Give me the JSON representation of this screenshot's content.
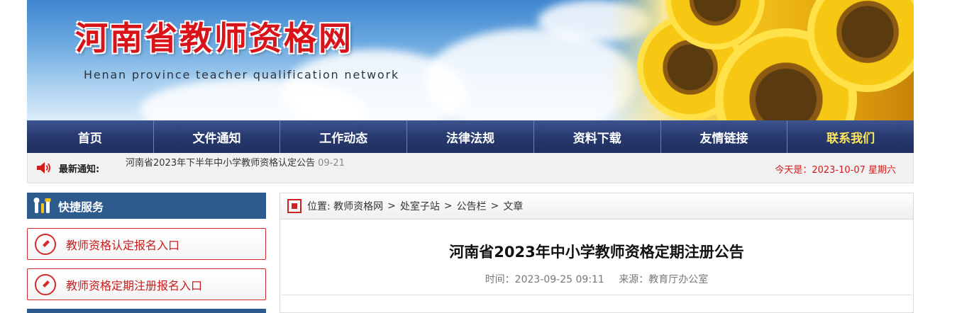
{
  "header": {
    "title": "河南省教师资格网",
    "subtitle": "Henan province teacher qualification network"
  },
  "nav": {
    "items": [
      {
        "label": "首页"
      },
      {
        "label": "文件通知"
      },
      {
        "label": "工作动态"
      },
      {
        "label": "法律法规"
      },
      {
        "label": "资料下载"
      },
      {
        "label": "友情链接"
      },
      {
        "label": "联系我们"
      }
    ],
    "highlight_color": "#ffe65a"
  },
  "notice": {
    "label": "最新通知:",
    "item_text": "河南省2023年下半年中小学教师资格认定公告",
    "item_date": "09-21",
    "today": "今天是：2023-10-07  星期六",
    "speaker_icon": "speaker-icon"
  },
  "sidebar": {
    "heading": "快捷服务",
    "heading_icon": "tools-icon",
    "buttons": [
      {
        "label": "教师资格认定报名入口",
        "icon": "pen-icon"
      },
      {
        "label": "教师资格定期注册报名入口",
        "icon": "pen-icon"
      }
    ]
  },
  "breadcrumb": {
    "prefix": "位置:",
    "items": [
      "教师资格网",
      "处室子站",
      "公告栏",
      "文章"
    ],
    "separator": ">"
  },
  "article": {
    "title": "河南省2023年中小学教师资格定期注册公告",
    "time": "时间：2023-09-25 09:11",
    "source": "来源：教育厅办公室"
  },
  "colors": {
    "nav_bg": "#27396e",
    "accent_red": "#d12b2b",
    "sidebar_blue": "#2e5b8e"
  }
}
